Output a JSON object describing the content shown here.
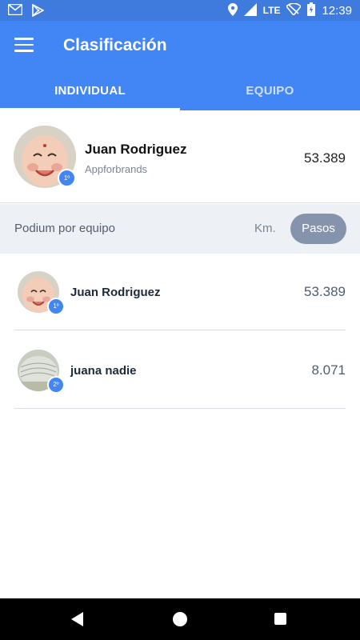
{
  "status_bar": {
    "time": "12:39",
    "network": "LTE",
    "icons": [
      "gmail-icon",
      "play-store-icon",
      "location-icon",
      "signal-icon",
      "wifi-icon",
      "battery-icon"
    ]
  },
  "app_bar": {
    "title": "Clasificación"
  },
  "tabs": [
    {
      "label": "INDIVIDUAL",
      "active": true
    },
    {
      "label": "EQUIPO",
      "active": false
    }
  ],
  "current_user": {
    "name": "Juan Rodriguez",
    "company": "Appforbrands",
    "score": "53.389",
    "rank": "1º"
  },
  "filter": {
    "label": "Podium por equipo",
    "km_label": "Km.",
    "pasos_label": "Pasos",
    "selected": "Pasos"
  },
  "ranking": [
    {
      "name": "Juan Rodriguez",
      "score": "53.389",
      "rank": "1º"
    },
    {
      "name": "juana nadie",
      "score": "8.071",
      "rank": "2º"
    }
  ],
  "colors": {
    "primary": "#4285f4",
    "status_bar": "#3f7bdc",
    "filter_bg": "#edf0f4",
    "selected_chip": "#8593ad"
  }
}
